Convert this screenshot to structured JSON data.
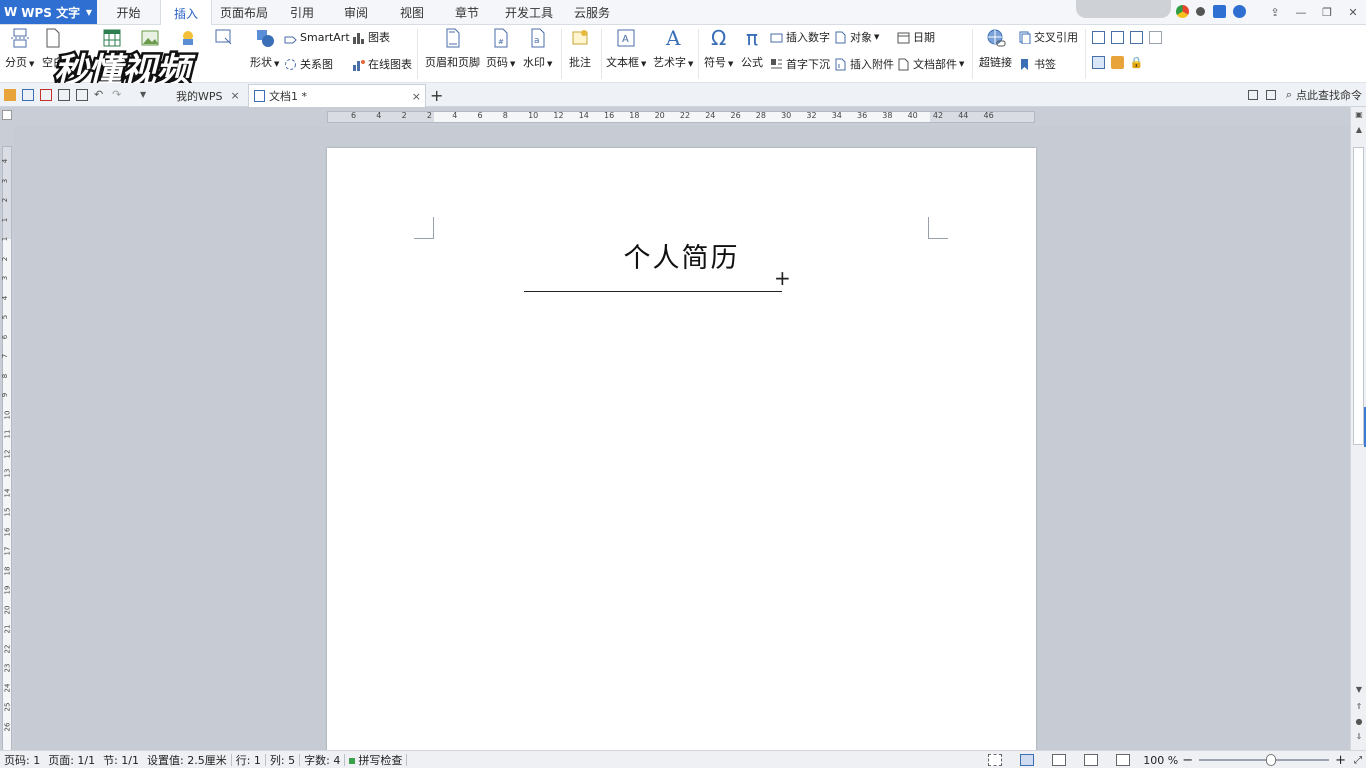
{
  "app": {
    "logo_letter": "W",
    "name": "WPS 文字"
  },
  "menu_tabs": [
    {
      "label": "开始",
      "width": 63
    },
    {
      "label": "插入",
      "width": 52,
      "active": true
    },
    {
      "label": "页面布局",
      "width": 64
    },
    {
      "label": "引用",
      "width": 52
    },
    {
      "label": "审阅",
      "width": 56
    },
    {
      "label": "视图",
      "width": 56
    },
    {
      "label": "章节",
      "width": 54
    },
    {
      "label": "开发工具",
      "width": 70
    },
    {
      "label": "云服务",
      "width": 56
    }
  ],
  "ribbon": {
    "page_break": "分页",
    "blank_page": "空白",
    "shapes": "形状",
    "smartart": "SmartArt",
    "chart": "图表",
    "relation_chart": "关系图",
    "online_chart": "在线图表",
    "header_footer": "页眉和页脚",
    "page_number": "页码",
    "watermark": "水印",
    "comment": "批注",
    "textbox": "文本框",
    "wordart": "艺术字",
    "symbol": "符号",
    "formula": "公式",
    "insert_number": "插入数字",
    "object": "对象",
    "date": "日期",
    "drop_cap": "首字下沉",
    "attachment": "插入附件",
    "doc_parts": "文档部件",
    "hyperlink": "超链接",
    "cross_ref": "交叉引用",
    "bookmark": "书签"
  },
  "watermark_brand": "秒懂视频",
  "doc_tabs": {
    "my_wps": "我的WPS",
    "doc1": "文档1 *",
    "close": "×",
    "add": "+"
  },
  "search_command": "点此查找命令",
  "ruler_labels": [
    "6",
    "4",
    "2",
    "2",
    "4",
    "6",
    "8",
    "10",
    "12",
    "14",
    "16",
    "18",
    "20",
    "22",
    "24",
    "26",
    "28",
    "30",
    "32",
    "34",
    "36",
    "38",
    "40",
    "42",
    "44",
    "46"
  ],
  "vruler_labels": [
    "4",
    "3",
    "2",
    "1",
    "1",
    "2",
    "3",
    "4",
    "5",
    "6",
    "7",
    "8",
    "9",
    "10",
    "11",
    "12",
    "13",
    "14",
    "15",
    "16",
    "17",
    "18",
    "19",
    "20",
    "21",
    "22",
    "23",
    "24",
    "25",
    "26"
  ],
  "document": {
    "title": "个人简历"
  },
  "status": {
    "page_num": "页码: 1",
    "pages": "页面: 1/1",
    "section": "节: 1/1",
    "setting": "设置值: 2.5厘米",
    "row": "行: 1",
    "col": "列: 5",
    "words": "字数: 4",
    "spell": "拼写检查",
    "zoom": "100 %"
  },
  "zoom_level": 0.55
}
